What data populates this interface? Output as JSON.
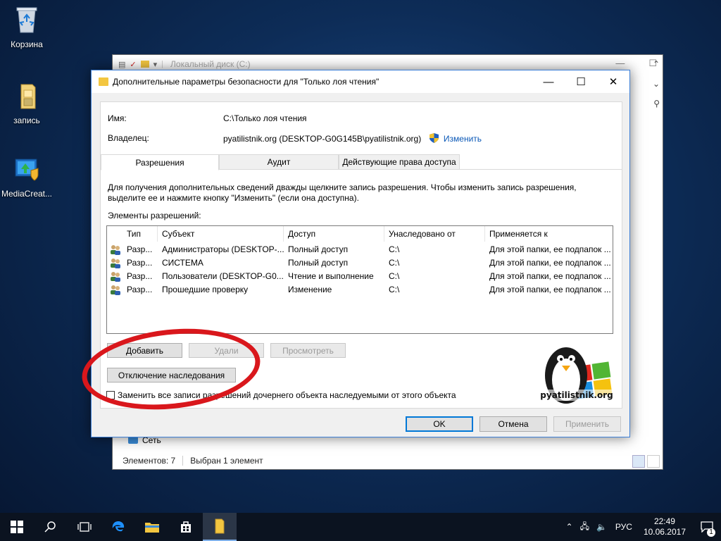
{
  "desktop": {
    "icons": [
      {
        "label": "Корзина"
      },
      {
        "label": "запись"
      },
      {
        "label": "MediaCreat..."
      }
    ]
  },
  "explorer": {
    "title": "Локальный диск (C:)",
    "nav_item_network": "Сеть",
    "status_items": "Элементов: 7",
    "status_selected": "Выбран 1 элемент"
  },
  "dialog": {
    "title": "Дополнительные параметры безопасности  для \"Только лоя чтения\"",
    "name_label": "Имя:",
    "name_value": "C:\\Только лоя чтения",
    "owner_label": "Владелец:",
    "owner_value": "pyatilistnik.org (DESKTOP-G0G145B\\pyatilistnik.org)",
    "owner_change": "Изменить",
    "tabs": [
      {
        "label": "Разрешения",
        "active": true
      },
      {
        "label": "Аудит",
        "active": false
      },
      {
        "label": "Действующие права доступа",
        "active": false
      }
    ],
    "info_text": "Для получения дополнительных сведений дважды щелкните запись разрешения. Чтобы изменить запись разрешения, выделите ее и нажмите кнопку \"Изменить\" (если она доступна).",
    "elements_label": "Элементы разрешений:",
    "table": {
      "columns": [
        "Тип",
        "Субъект",
        "Доступ",
        "Унаследовано от",
        "Применяется к"
      ],
      "rows": [
        {
          "type": "Разр...",
          "subject": "Администраторы (DESKTOP-...",
          "access": "Полный доступ",
          "inherited": "C:\\",
          "applies": "Для этой папки, ее подпапок ..."
        },
        {
          "type": "Разр...",
          "subject": "СИСТЕМА",
          "access": "Полный доступ",
          "inherited": "C:\\",
          "applies": "Для этой папки, ее подпапок ..."
        },
        {
          "type": "Разр...",
          "subject": "Пользователи (DESKTOP-G0...",
          "access": "Чтение и выполнение",
          "inherited": "C:\\",
          "applies": "Для этой папки, ее подпапок ..."
        },
        {
          "type": "Разр...",
          "subject": "Прошедшие проверку",
          "access": "Изменение",
          "inherited": "C:\\",
          "applies": "Для этой папки, ее подпапок ..."
        }
      ]
    },
    "btn_add": "Добавить",
    "btn_delete": "Удали",
    "btn_view": "Просмотреть",
    "btn_disable_inheritance": "Отключение наследования",
    "replace_checkbox_label": "Заменить все записи разрешений дочернего объекта наследуемыми от этого объекта",
    "btn_ok": "OK",
    "btn_cancel": "Отмена",
    "btn_apply": "Применить",
    "logo_text": "pyatilistnik.org"
  },
  "taskbar": {
    "lang": "РУС",
    "time": "22:49",
    "date": "10.06.2017",
    "notifications": "1"
  },
  "colors": {
    "accent": "#0078d7",
    "link": "#0a58b7",
    "highlight": "#d9171c",
    "taskbar": "#0b1320"
  }
}
